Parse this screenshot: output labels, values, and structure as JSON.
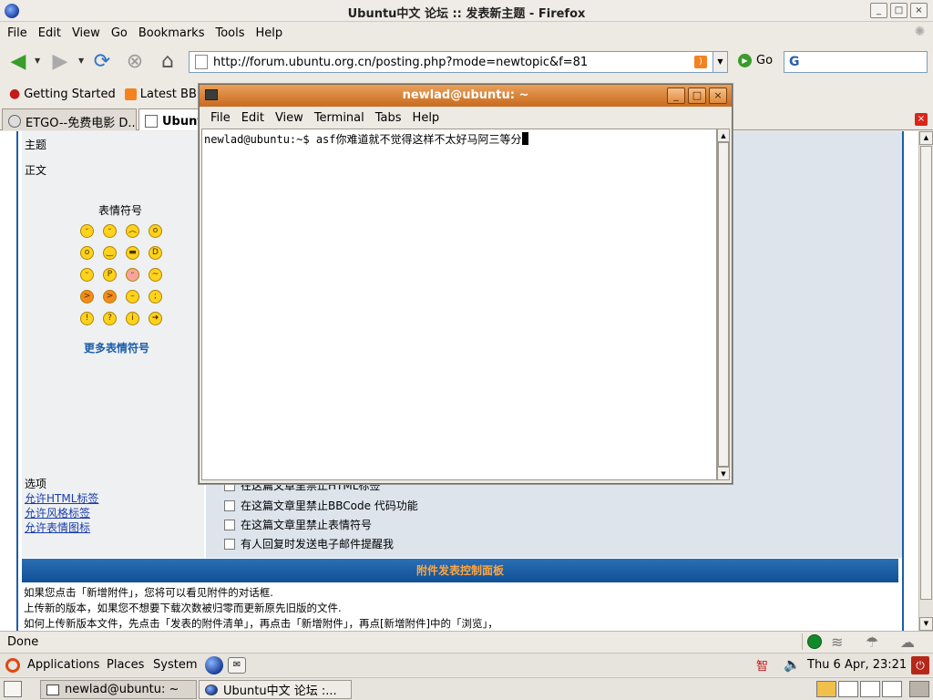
{
  "browser": {
    "title": "Ubuntu中文 论坛 :: 发表新主题 - Firefox",
    "menus": [
      "File",
      "Edit",
      "View",
      "Go",
      "Bookmarks",
      "Tools",
      "Help"
    ],
    "url": "http://forum.ubuntu.org.cn/posting.php?mode=newtopic&f=81",
    "go_label": "Go",
    "bookmarks": [
      "Getting Started",
      "Latest BB"
    ],
    "tabs": [
      "ETGO--免费电影 D...",
      "Ubunt"
    ],
    "status": "Done"
  },
  "page": {
    "subject_label": "主题",
    "body_label": "正文",
    "smilies_title": "表情符号",
    "more_smilies": "更多表情符号",
    "options_left": [
      "选项",
      "允许HTML标签",
      "允许风格标签",
      "允许表情图标"
    ],
    "options_right": [
      "在这篇文章里禁止HTML标签",
      "在这篇文章里禁止BBCode 代码功能",
      "在这篇文章里禁止表情符号",
      "有人回复时发送电子邮件提醒我"
    ],
    "attach_title": "附件发表控制面板",
    "attach_lines": [
      "如果您点击「新增附件」，您将可以看见附件的对话框.",
      "上传新的版本，如果您不想要下载次数被归零而更新原先旧版的文件.",
      "如何上传新版本文件，先点击「发表的附件清单」，再点击「新增附件」，再点[新增附件]中的「浏览」，"
    ]
  },
  "terminal": {
    "title": "newlad@ubuntu: ~",
    "menus": [
      "File",
      "Edit",
      "View",
      "Terminal",
      "Tabs",
      "Help"
    ],
    "prompt": "newlad@ubuntu:~$ asf你难道就不觉得这样不太好马阿三等分"
  },
  "panel": {
    "menus": [
      "Applications",
      "Places",
      "System"
    ],
    "ime": "智",
    "clock": "Thu  6 Apr, 23:21",
    "tasks": [
      "newlad@ubuntu: ~",
      "Ubuntu中文 论坛 :..."
    ]
  }
}
